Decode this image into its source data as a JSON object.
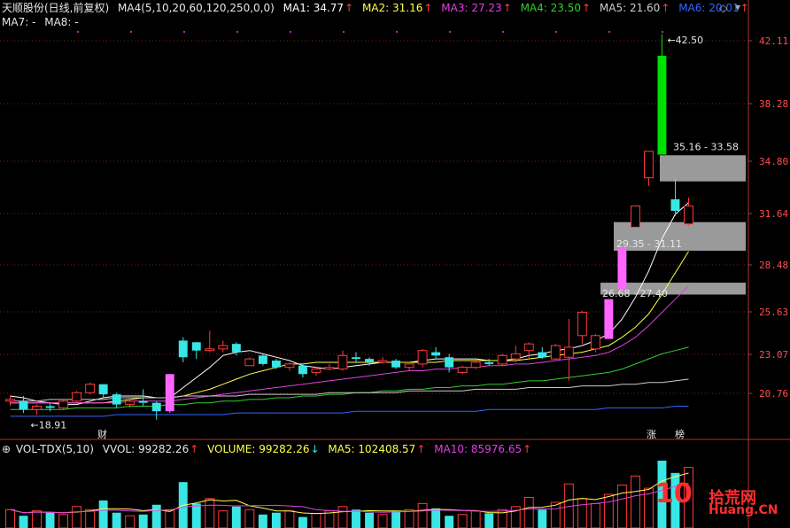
{
  "header": {
    "stock": "天顺股份(日线,前复权)",
    "ma_def": "MA4(5,10,20,60,120,250,0,0)",
    "ma1": "MA1: 34.77",
    "ma2": "MA2: 31.16",
    "ma3": "MA3: 27.23",
    "ma4": "MA4: 23.50",
    "ma5": "MA5: 21.60",
    "ma6": "MA6: 20.01",
    "ma7": "MA7: -",
    "ma8": "MA8: -",
    "arrow": "↑"
  },
  "volume_header": {
    "indicator": "VOL-TDX(5,10)",
    "vvol": "VVOL: 99282.26",
    "volume": "VOLUME: 99282.26",
    "ma5": "MA5: 102408.57",
    "ma10": "MA10: 85976.65",
    "down_arrow": "↓"
  },
  "colors": {
    "up": "#ff3b3b",
    "down": "#39e6e6",
    "limit_up": "#ff66ff",
    "spike": "#00e000",
    "ma1": "#ffffff",
    "ma2": "#ffff4d",
    "ma3": "#e040e0",
    "ma4": "#33cc33",
    "ma5": "#cccccc",
    "ma6": "#3366ff",
    "zone": "#9a9a9a"
  },
  "annotations": {
    "high": "42.50",
    "low": "18.91",
    "zone1": "35.16 - 33.58",
    "zone2": "29.35 - 31.11",
    "zone3": "26.68 - 27.40",
    "cai": "财",
    "zhang": "涨",
    "bang": "榜"
  },
  "watermark": {
    "big": "10",
    "cn": "拾荒网",
    "domain": "Huang.CN"
  },
  "chart_data": [
    {
      "type": "candlestick",
      "title": "天顺股份(日线,前复权)",
      "y_ticks": [
        20.76,
        23.07,
        25.63,
        28.48,
        31.64,
        34.8,
        38.28,
        42.11
      ],
      "ylim": [
        18.6,
        43.2
      ],
      "grid": true,
      "ohlc": [
        [
          20.3,
          20.6,
          20.0,
          20.4
        ],
        [
          20.3,
          20.6,
          19.6,
          19.8
        ],
        [
          19.8,
          20.1,
          19.5,
          20.0
        ],
        [
          20.0,
          20.2,
          19.7,
          19.9
        ],
        [
          19.9,
          20.4,
          19.8,
          20.3
        ],
        [
          20.3,
          20.9,
          20.2,
          20.8
        ],
        [
          20.8,
          21.4,
          20.7,
          21.3
        ],
        [
          21.3,
          21.3,
          20.5,
          20.7
        ],
        [
          20.7,
          20.8,
          19.9,
          20.1
        ],
        [
          20.1,
          20.4,
          19.9,
          20.3
        ],
        [
          20.3,
          21.0,
          20.0,
          20.2
        ],
        [
          20.2,
          20.3,
          19.2,
          19.7
        ],
        [
          19.7,
          21.9,
          19.6,
          21.9
        ],
        [
          23.9,
          24.1,
          22.6,
          22.9
        ],
        [
          23.8,
          23.8,
          22.8,
          23.3
        ],
        [
          23.3,
          24.5,
          23.2,
          23.4
        ],
        [
          23.4,
          23.9,
          23.2,
          23.6
        ],
        [
          23.7,
          23.8,
          23.0,
          23.2
        ],
        [
          22.4,
          22.9,
          22.4,
          22.8
        ],
        [
          23.0,
          23.1,
          22.4,
          22.5
        ],
        [
          22.7,
          22.8,
          22.2,
          22.3
        ],
        [
          22.3,
          22.6,
          22.1,
          22.5
        ],
        [
          22.4,
          22.5,
          21.7,
          21.9
        ],
        [
          22.0,
          22.3,
          21.8,
          22.2
        ],
        [
          22.2,
          22.5,
          22.1,
          22.3
        ],
        [
          22.2,
          23.3,
          22.1,
          23.0
        ],
        [
          22.9,
          23.2,
          22.6,
          22.8
        ],
        [
          22.8,
          22.9,
          22.4,
          22.6
        ],
        [
          22.6,
          22.9,
          22.5,
          22.7
        ],
        [
          22.7,
          22.8,
          22.2,
          22.3
        ],
        [
          22.3,
          22.6,
          22.1,
          22.5
        ],
        [
          22.5,
          23.4,
          22.3,
          23.3
        ],
        [
          23.2,
          23.5,
          22.8,
          23.0
        ],
        [
          22.9,
          23.1,
          22.0,
          22.3
        ],
        [
          22.0,
          22.4,
          21.9,
          22.3
        ],
        [
          22.3,
          22.7,
          22.2,
          22.6
        ],
        [
          22.6,
          22.8,
          22.4,
          22.5
        ],
        [
          22.5,
          23.1,
          22.4,
          23.0
        ],
        [
          22.8,
          23.6,
          22.6,
          23.1
        ],
        [
          23.3,
          23.8,
          22.8,
          23.7
        ],
        [
          23.2,
          23.5,
          22.8,
          22.9
        ],
        [
          22.8,
          23.7,
          22.7,
          23.6
        ],
        [
          22.9,
          25.2,
          21.5,
          23.5
        ],
        [
          24.2,
          25.7,
          23.7,
          25.6
        ],
        [
          23.4,
          24.3,
          23.2,
          24.2
        ],
        [
          24.0,
          26.4,
          24.0,
          26.4
        ],
        [
          27.0,
          29.5,
          26.9,
          29.5
        ],
        [
          30.8,
          32.1,
          30.8,
          32.1
        ],
        [
          33.8,
          35.4,
          33.3,
          35.4
        ],
        [
          41.2,
          42.5,
          35.2,
          35.2
        ],
        [
          32.5,
          33.8,
          31.5,
          31.8
        ],
        [
          31.0,
          32.6,
          30.9,
          32.1
        ]
      ],
      "series": [
        {
          "name": "MA1",
          "values": [
            20.6,
            20.5,
            20.3,
            20.2,
            20.1,
            20.1,
            20.3,
            20.5,
            20.6,
            20.6,
            20.6,
            20.5,
            20.5,
            21.1,
            21.7,
            22.3,
            23.0,
            23.2,
            23.3,
            23.1,
            22.9,
            22.7,
            22.4,
            22.3,
            22.2,
            22.3,
            22.4,
            22.5,
            22.6,
            22.6,
            22.6,
            22.7,
            22.8,
            22.8,
            22.8,
            22.8,
            22.7,
            22.7,
            22.8,
            23.0,
            23.1,
            23.3,
            23.4,
            23.6,
            23.9,
            24.3,
            25.2,
            26.5,
            28.1,
            30.1,
            31.6,
            32.3
          ]
        },
        {
          "name": "MA2",
          "values": [
            20.2,
            20.2,
            20.2,
            20.2,
            20.2,
            20.2,
            20.2,
            20.2,
            20.3,
            20.4,
            20.5,
            20.5,
            20.5,
            20.6,
            20.8,
            21.0,
            21.3,
            21.6,
            21.9,
            22.1,
            22.3,
            22.5,
            22.5,
            22.6,
            22.6,
            22.6,
            22.6,
            22.6,
            22.6,
            22.6,
            22.6,
            22.6,
            22.6,
            22.7,
            22.7,
            22.7,
            22.7,
            22.7,
            22.7,
            22.8,
            22.9,
            23.0,
            23.1,
            23.2,
            23.4,
            23.6,
            24.1,
            24.7,
            25.5,
            26.7,
            28.0,
            29.3
          ]
        },
        {
          "name": "MA3",
          "values": [
            20.2,
            20.2,
            20.2,
            20.2,
            20.2,
            20.2,
            20.2,
            20.2,
            20.2,
            20.3,
            20.3,
            20.3,
            20.3,
            20.4,
            20.5,
            20.6,
            20.7,
            20.8,
            20.9,
            21.0,
            21.1,
            21.2,
            21.3,
            21.4,
            21.5,
            21.6,
            21.7,
            21.8,
            21.9,
            22.0,
            22.1,
            22.1,
            22.2,
            22.2,
            22.3,
            22.3,
            22.4,
            22.4,
            22.5,
            22.5,
            22.6,
            22.7,
            22.8,
            22.9,
            23.0,
            23.2,
            23.6,
            24.1,
            24.8,
            25.6,
            26.4,
            27.2
          ]
        },
        {
          "name": "MA4",
          "values": [
            19.8,
            19.8,
            19.8,
            19.8,
            19.8,
            19.9,
            19.9,
            19.9,
            19.9,
            20.0,
            20.0,
            20.0,
            20.1,
            20.1,
            20.2,
            20.2,
            20.3,
            20.3,
            20.4,
            20.4,
            20.5,
            20.5,
            20.6,
            20.6,
            20.7,
            20.7,
            20.8,
            20.8,
            20.9,
            20.9,
            21.0,
            21.0,
            21.1,
            21.1,
            21.2,
            21.2,
            21.3,
            21.3,
            21.4,
            21.5,
            21.5,
            21.6,
            21.7,
            21.8,
            21.9,
            22.0,
            22.2,
            22.5,
            22.8,
            23.1,
            23.3,
            23.5
          ]
        },
        {
          "name": "MA5",
          "values": [
            20.3,
            20.3,
            20.3,
            20.4,
            20.4,
            20.4,
            20.4,
            20.4,
            20.5,
            20.5,
            20.5,
            20.5,
            20.5,
            20.6,
            20.6,
            20.6,
            20.6,
            20.6,
            20.7,
            20.7,
            20.7,
            20.7,
            20.7,
            20.7,
            20.8,
            20.8,
            20.8,
            20.8,
            20.8,
            20.8,
            20.9,
            20.9,
            20.9,
            20.9,
            20.9,
            21.0,
            21.0,
            21.0,
            21.0,
            21.1,
            21.1,
            21.1,
            21.1,
            21.2,
            21.2,
            21.2,
            21.3,
            21.3,
            21.4,
            21.4,
            21.5,
            21.6
          ]
        },
        {
          "name": "MA6",
          "values": [
            19.4,
            19.4,
            19.4,
            19.4,
            19.4,
            19.4,
            19.4,
            19.4,
            19.5,
            19.5,
            19.5,
            19.5,
            19.5,
            19.5,
            19.5,
            19.5,
            19.5,
            19.6,
            19.6,
            19.6,
            19.6,
            19.6,
            19.6,
            19.6,
            19.6,
            19.6,
            19.7,
            19.7,
            19.7,
            19.7,
            19.7,
            19.7,
            19.7,
            19.7,
            19.7,
            19.7,
            19.8,
            19.8,
            19.8,
            19.8,
            19.8,
            19.8,
            19.8,
            19.8,
            19.8,
            19.9,
            19.9,
            19.9,
            19.9,
            19.9,
            20.0,
            20.0
          ]
        }
      ],
      "zones": [
        [
          33.58,
          35.16
        ],
        [
          29.35,
          31.11
        ],
        [
          26.68,
          27.4
        ]
      ]
    },
    {
      "type": "bar",
      "title": "VOL-TDX(5,10)",
      "values": [
        30,
        20,
        28,
        25,
        22,
        35,
        30,
        45,
        25,
        20,
        22,
        38,
        30,
        75,
        40,
        48,
        28,
        35,
        30,
        22,
        25,
        28,
        18,
        24,
        28,
        35,
        30,
        25,
        22,
        28,
        30,
        40,
        32,
        20,
        22,
        28,
        24,
        30,
        35,
        50,
        30,
        42,
        72,
        48,
        40,
        55,
        70,
        85,
        65,
        110,
        90,
        99
      ],
      "ylim": [
        0,
        110
      ]
    }
  ]
}
